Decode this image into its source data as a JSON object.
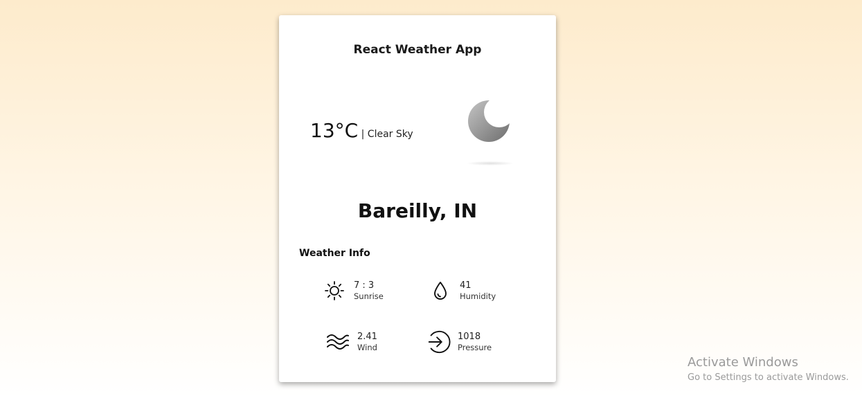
{
  "app": {
    "title": "React Weather App"
  },
  "current": {
    "temperature": "13°C",
    "description": " | Clear Sky",
    "icon": "moon-icon"
  },
  "location": {
    "city": "Bareilly, IN"
  },
  "weather_info": {
    "heading": "Weather Info",
    "items": [
      {
        "value": "7 : 3",
        "label": "Sunrise",
        "icon": "sun-icon"
      },
      {
        "value": "41",
        "label": "Humidity",
        "icon": "droplet-icon"
      },
      {
        "value": "2.41",
        "label": "Wind",
        "icon": "wind-icon"
      },
      {
        "value": "1018",
        "label": "Pressure",
        "icon": "pressure-icon"
      }
    ]
  },
  "watermark": {
    "title": "Activate Windows",
    "subtitle": "Go to Settings to activate Windows."
  }
}
